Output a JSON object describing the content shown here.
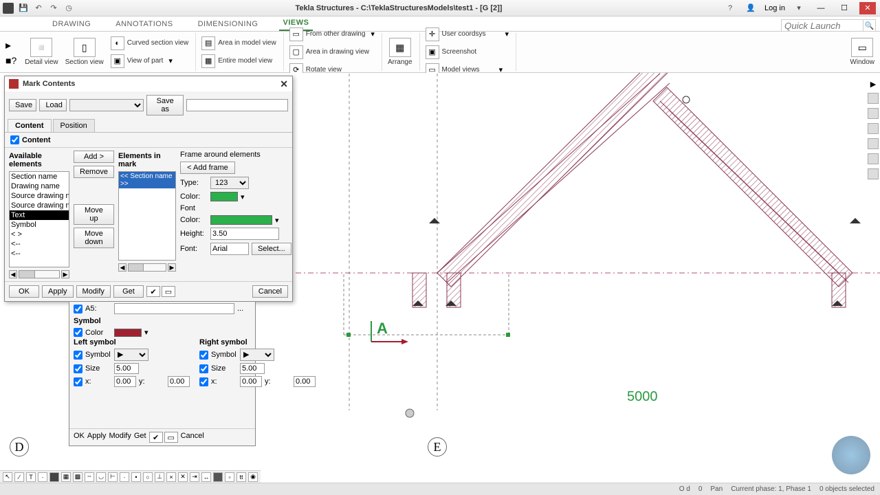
{
  "titlebar": {
    "title": "Tekla Structures - C:\\TeklaStructuresModels\\test1 - [G  [2]]",
    "login": "Log in"
  },
  "ribbon_tabs": {
    "drawing": "DRAWING",
    "annotations": "ANNOTATIONS",
    "dimensioning": "DIMENSIONING",
    "views": "VIEWS"
  },
  "quick_launch_placeholder": "Quick Launch",
  "ribbon": {
    "detail_view": "Detail view",
    "section_view": "Section view",
    "curved_section": "Curved section view",
    "view_of_part": "View of part",
    "area_model_view": "Area in model view",
    "entire_model_view": "Entire model view",
    "from_other": "From other drawing",
    "area_drawing_view": "Area in drawing view",
    "rotate_view": "Rotate view",
    "arrange": "Arrange",
    "user_coordsys": "User coordsys",
    "screenshot": "Screenshot",
    "model_views": "Model views",
    "window": "Window"
  },
  "dialog": {
    "title": "Mark Contents",
    "save": "Save",
    "load": "Load",
    "save_as": "Save as",
    "tab_content": "Content",
    "tab_position": "Position",
    "content_chk": "Content",
    "available_head": "Available elements",
    "elements_head": "Elements in mark",
    "frame_head": "Frame around elements",
    "available_list": [
      "Section name",
      "Drawing name",
      "Source drawing nam",
      "Source drawing nam",
      "Text",
      "Symbol",
      "<  >",
      "<--",
      "<--"
    ],
    "mark_item": "<< Section name >>",
    "add": "Add >",
    "remove": "Remove",
    "move_up": "Move up",
    "move_down": "Move down",
    "add_frame": "< Add frame",
    "type_lbl": "Type:",
    "type_val": "123",
    "color_lbl": "Color:",
    "font_head": "Font",
    "height_lbl": "Height:",
    "height_val": "3.50",
    "font_lbl": "Font:",
    "font_val": "Arial",
    "select": "Select...",
    "ok": "OK",
    "apply": "Apply",
    "modify": "Modify",
    "get": "Get",
    "cancel": "Cancel"
  },
  "prop": {
    "a5_lbl": "A5:",
    "symbol_head": "Symbol",
    "color_lbl": "Color",
    "left_sym": "Left symbol",
    "right_sym": "Right symbol",
    "symbol_lbl": "Symbol",
    "size_lbl": "Size",
    "size_val": "5.00",
    "x_lbl": "x:",
    "y_lbl": "y:",
    "zero": "0.00",
    "ok": "OK",
    "apply": "Apply",
    "modify": "Modify",
    "get": "Get",
    "cancel": "Cancel",
    "browse": "..."
  },
  "canvas": {
    "marker_A": "A",
    "dim_5000": "5000",
    "label_D": "D",
    "label_E": "E"
  },
  "status": {
    "od": "O d",
    "zero": "0",
    "pan": "Pan",
    "phase": "Current phase: 1, Phase 1",
    "sel": "0 objects selected"
  }
}
